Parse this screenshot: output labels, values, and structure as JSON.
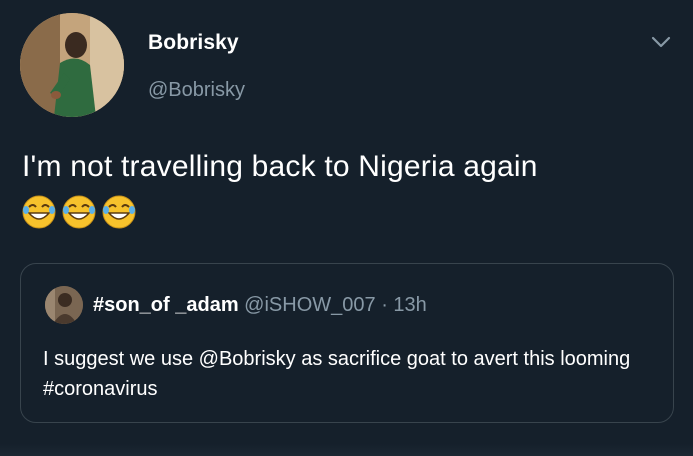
{
  "author": {
    "display_name": "Bobrisky",
    "handle": "@Bobrisky",
    "avatar_icon": "profile-photo"
  },
  "tweet": {
    "text": "I'm not travelling back to Nigeria again",
    "emojis": [
      "face-with-tears-of-joy",
      "face-with-tears-of-joy",
      "face-with-tears-of-joy"
    ]
  },
  "quoted_tweet": {
    "display_name": "#son_of _adam",
    "handle": "@iSHOW_007",
    "separator": " · ",
    "time": "13h",
    "text": "I suggest we use @Bobrisky as sacrifice goat to avert this looming #coronavirus"
  },
  "colors": {
    "background": "#15202b",
    "secondary_text": "#8899a6",
    "border": "#38444d",
    "emoji_yellow": "#f7c22c"
  }
}
